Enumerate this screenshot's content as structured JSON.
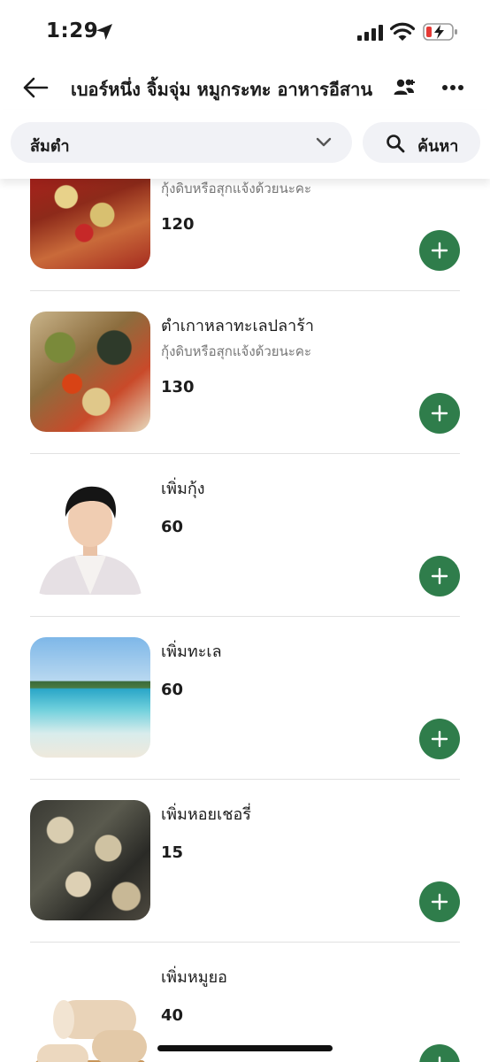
{
  "status_bar": {
    "time": "1:29"
  },
  "nav": {
    "title": "เบอร์หนึ่ง จิ้มจุ่ม หมูกระทะ อาหารอีสาน"
  },
  "filter": {
    "category": "ส้มตำ",
    "search_label": "ค้นหา"
  },
  "items": [
    {
      "name": "",
      "desc": "กุ้งดิบหรือสุกแจ้งด้วยนะคะ",
      "price": "120",
      "image": "papaya-salad-image"
    },
    {
      "name": "ตำเกาหลาทะเลปลาร้า",
      "desc": "กุ้งดิบหรือสุกแจ้งด้วยนะคะ",
      "price": "130",
      "image": "seafood-papaya-salad-image"
    },
    {
      "name": "เพิ่มกุ้ง",
      "desc": "",
      "price": "60",
      "image": "man-portrait-image"
    },
    {
      "name": "เพิ่มทะเล",
      "desc": "",
      "price": "60",
      "image": "beach-image"
    },
    {
      "name": "เพิ่มหอยเชอรี่",
      "desc": "",
      "price": "15",
      "image": "snails-image"
    },
    {
      "name": "เพิ่มหมูยอ",
      "desc": "",
      "price": "40",
      "image": "pork-sausage-image"
    }
  ],
  "colors": {
    "accent": "#2f7d4b",
    "pill_bg": "#f1f2f6",
    "battery_low": "#e53935"
  }
}
